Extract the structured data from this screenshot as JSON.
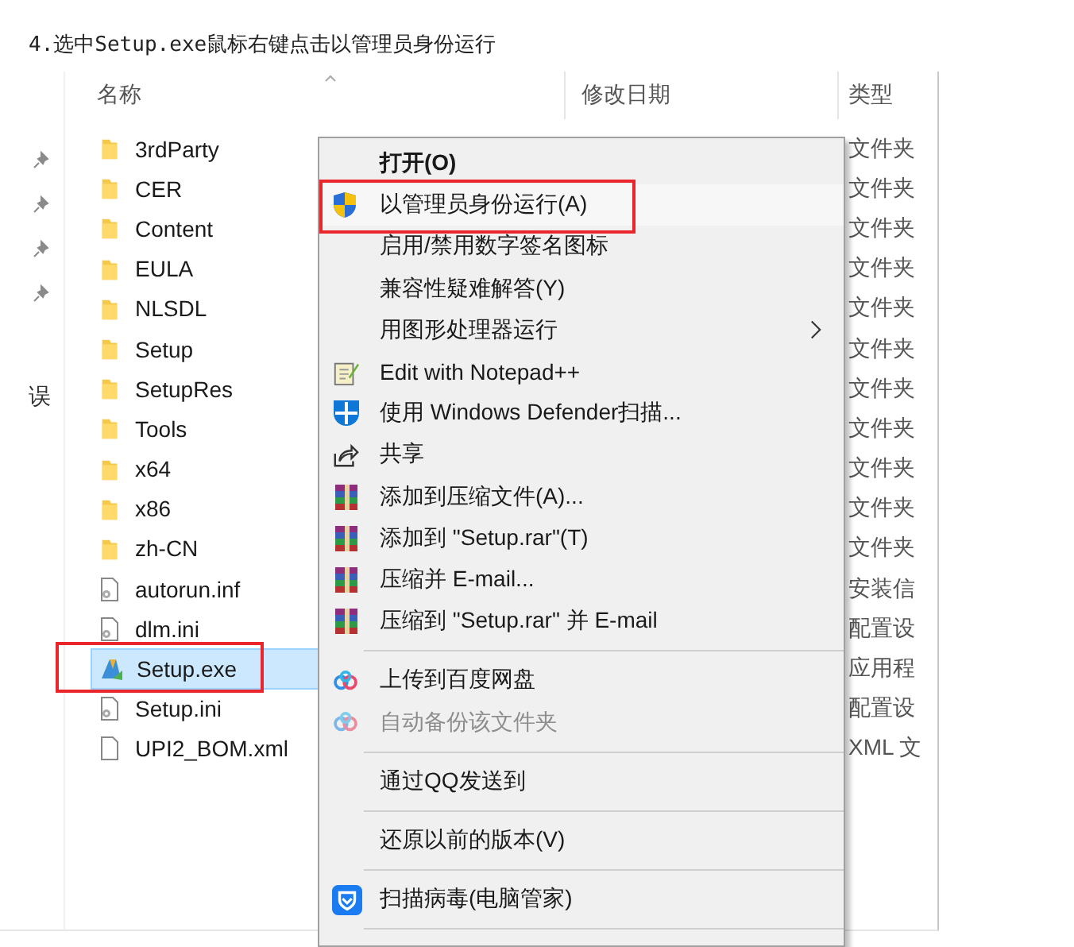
{
  "caption": "4.选中Setup.exe鼠标右键点击以管理员身份运行",
  "nav": {
    "pinned_count_text": "误"
  },
  "columns": [
    "名称",
    "修改日期",
    "类型"
  ],
  "files": [
    {
      "name": "3rdParty",
      "kind": "folder",
      "type": "文件夹",
      "selected": false,
      "annotated": false
    },
    {
      "name": "CER",
      "kind": "folder",
      "type": "文件夹",
      "selected": false,
      "annotated": false
    },
    {
      "name": "Content",
      "kind": "folder",
      "type": "文件夹",
      "selected": false,
      "annotated": false
    },
    {
      "name": "EULA",
      "kind": "folder",
      "type": "文件夹",
      "selected": false,
      "annotated": false
    },
    {
      "name": "NLSDL",
      "kind": "folder",
      "type": "文件夹",
      "selected": false,
      "annotated": false
    },
    {
      "name": "Setup",
      "kind": "folder",
      "type": "文件夹",
      "selected": false,
      "annotated": false
    },
    {
      "name": "SetupRes",
      "kind": "folder",
      "type": "文件夹",
      "selected": false,
      "annotated": false
    },
    {
      "name": "Tools",
      "kind": "folder",
      "type": "文件夹",
      "selected": false,
      "annotated": false
    },
    {
      "name": "x64",
      "kind": "folder",
      "type": "文件夹",
      "selected": false,
      "annotated": false
    },
    {
      "name": "x86",
      "kind": "folder",
      "type": "文件夹",
      "selected": false,
      "annotated": false
    },
    {
      "name": "zh-CN",
      "kind": "folder",
      "type": "文件夹",
      "selected": false,
      "annotated": false
    },
    {
      "name": "autorun.inf",
      "kind": "config",
      "type": "安装信",
      "selected": false,
      "annotated": false
    },
    {
      "name": "dlm.ini",
      "kind": "config",
      "type": "配置设",
      "selected": false,
      "annotated": false
    },
    {
      "name": "Setup.exe",
      "kind": "exe",
      "type": "应用程",
      "selected": true,
      "annotated": true
    },
    {
      "name": "Setup.ini",
      "kind": "config",
      "type": "配置设",
      "selected": false,
      "annotated": false
    },
    {
      "name": "UPI2_BOM.xml",
      "kind": "file",
      "type": "XML 文",
      "selected": false,
      "annotated": false
    }
  ],
  "context_menu": [
    {
      "kind": "plain",
      "label": "打开(O)",
      "default": true,
      "disabled": false,
      "submenu": false,
      "annotated": false
    },
    {
      "kind": "uac",
      "label": "以管理员身份运行(A)",
      "default": false,
      "disabled": false,
      "submenu": false,
      "annotated": true
    },
    {
      "kind": "plain",
      "label": "启用/禁用数字签名图标",
      "default": false,
      "disabled": false,
      "submenu": false,
      "annotated": false
    },
    {
      "kind": "plain",
      "label": "兼容性疑难解答(Y)",
      "default": false,
      "disabled": false,
      "submenu": false,
      "annotated": false
    },
    {
      "kind": "plain",
      "label": "用图形处理器运行",
      "default": false,
      "disabled": false,
      "submenu": true,
      "annotated": false
    },
    {
      "kind": "notepad",
      "label": "Edit with Notepad++",
      "default": false,
      "disabled": false,
      "submenu": false,
      "annotated": false
    },
    {
      "kind": "defender",
      "label": "使用 Windows Defender扫描...",
      "default": false,
      "disabled": false,
      "submenu": false,
      "annotated": false
    },
    {
      "kind": "share",
      "label": "共享",
      "default": false,
      "disabled": false,
      "submenu": false,
      "annotated": false
    },
    {
      "kind": "rar",
      "label": "添加到压缩文件(A)...",
      "default": false,
      "disabled": false,
      "submenu": false,
      "annotated": false
    },
    {
      "kind": "rar",
      "label": "添加到 \"Setup.rar\"(T)",
      "default": false,
      "disabled": false,
      "submenu": false,
      "annotated": false
    },
    {
      "kind": "rar",
      "label": "压缩并 E-mail...",
      "default": false,
      "disabled": false,
      "submenu": false,
      "annotated": false
    },
    {
      "kind": "rar",
      "label": "压缩到 \"Setup.rar\" 并 E-mail",
      "default": false,
      "disabled": false,
      "submenu": false,
      "annotated": false
    },
    {
      "kind": "separator"
    },
    {
      "kind": "cloud",
      "label": "上传到百度网盘",
      "default": false,
      "disabled": false,
      "submenu": false,
      "annotated": false
    },
    {
      "kind": "cloud",
      "label": "自动备份该文件夹",
      "default": false,
      "disabled": true,
      "submenu": false,
      "annotated": false
    },
    {
      "kind": "separator"
    },
    {
      "kind": "plain",
      "label": "通过QQ发送到",
      "default": false,
      "disabled": false,
      "submenu": false,
      "annotated": false
    },
    {
      "kind": "separator"
    },
    {
      "kind": "plain",
      "label": "还原以前的版本(V)",
      "default": false,
      "disabled": false,
      "submenu": false,
      "annotated": false
    },
    {
      "kind": "separator"
    },
    {
      "kind": "guard",
      "label": "扫描病毒(电脑管家)",
      "default": false,
      "disabled": false,
      "submenu": false,
      "annotated": false
    },
    {
      "kind": "separator"
    }
  ]
}
